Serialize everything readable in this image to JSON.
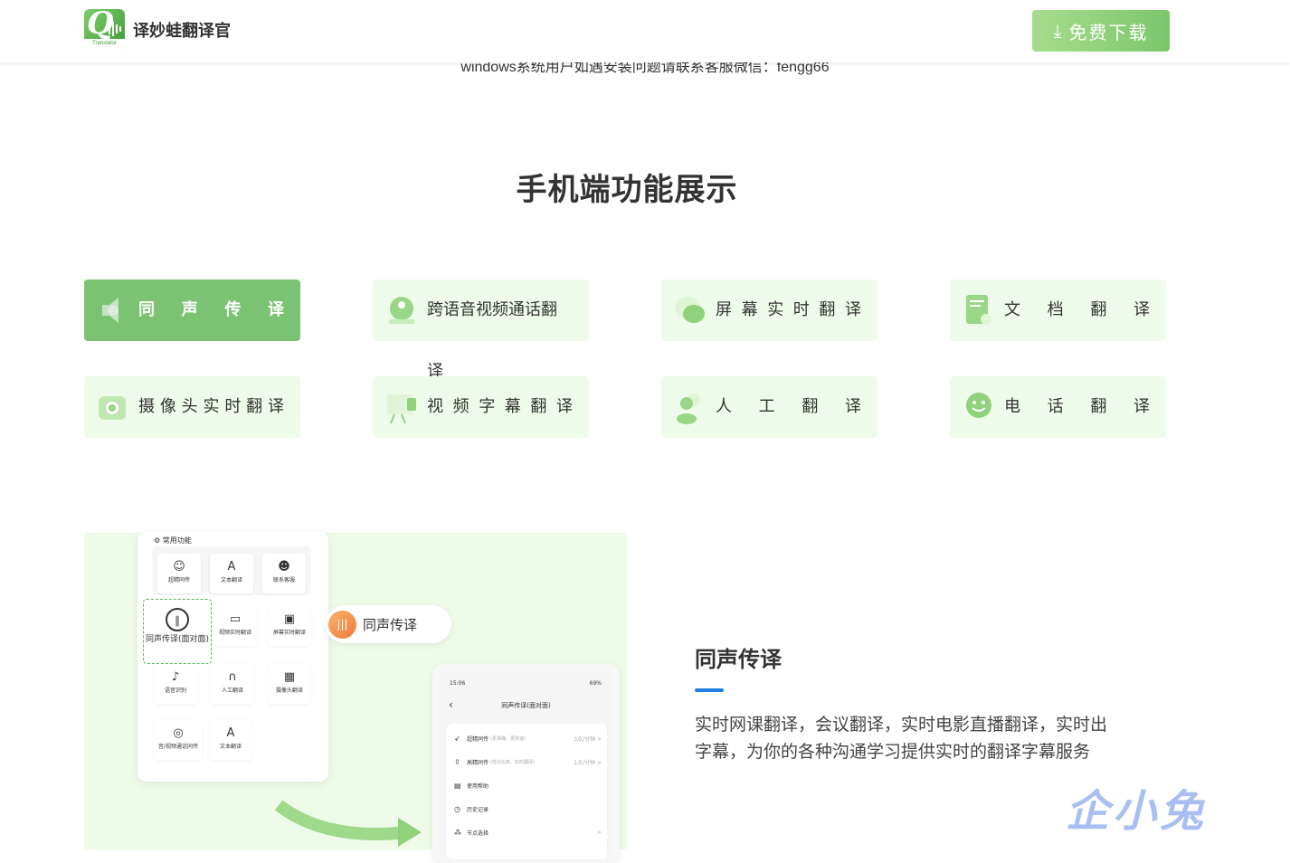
{
  "header": {
    "logo_tag": "Translator",
    "brand": "译妙蛙翻译官",
    "download_label": "免费下载",
    "download_icon": "download-icon"
  },
  "notice": "windows系统用户如遇安装问题请联系客服微信：fengg66",
  "section_title": "手机端功能展示",
  "tabs": [
    {
      "label": "同声传译",
      "icon": "speaker-icon",
      "active": true
    },
    {
      "label": "跨语音视频通话翻译",
      "icon": "video-call-icon",
      "active": false
    },
    {
      "label": "屏幕实时翻译",
      "icon": "chat-bubble-icon",
      "active": false
    },
    {
      "label": "文档翻译",
      "icon": "document-icon",
      "active": false
    },
    {
      "label": "摄像头实时翻译",
      "icon": "camera-icon",
      "active": false
    },
    {
      "label": "视频字幕翻译",
      "icon": "projector-icon",
      "active": false
    },
    {
      "label": "人工翻译",
      "icon": "people-icon",
      "active": false
    },
    {
      "label": "电话翻译",
      "icon": "phone-smile-icon",
      "active": false
    }
  ],
  "demo": {
    "panel_title": "常用功能",
    "items": [
      {
        "label": "超精同传",
        "glyph": "☺"
      },
      {
        "label": "文本翻译",
        "glyph": "A"
      },
      {
        "label": "联系客服",
        "glyph": "☻"
      },
      {
        "label": "同声传译(面对面)",
        "glyph": "∥"
      },
      {
        "label": "视频实时翻译",
        "glyph": "▭"
      },
      {
        "label": "屏幕实时翻译",
        "glyph": "▣"
      },
      {
        "label": "语音识别",
        "glyph": "♪"
      },
      {
        "label": "人工翻译",
        "glyph": "∩"
      },
      {
        "label": "摄像头翻译",
        "glyph": "▦"
      },
      {
        "label": "音/视频通话同传",
        "glyph": "◎"
      },
      {
        "label": "文本翻译",
        "glyph": "A"
      }
    ],
    "pill_label": "同声传译",
    "phone": {
      "time": "15:06",
      "status": "69%",
      "title": "同声传译(面对面)",
      "rows": [
        {
          "label": "超精同传",
          "sub": "(更准确、更快速)",
          "right": "3点/分钟 >"
        },
        {
          "label": "高精同传",
          "sub": "(性价比高、实时翻译)",
          "right": "1点/分钟 >"
        },
        {
          "label": "使用帮助",
          "sub": "",
          "right": ""
        },
        {
          "label": "历史记录",
          "sub": "",
          "right": ""
        },
        {
          "label": "节点选择",
          "sub": "",
          "right": ">"
        }
      ]
    }
  },
  "feature": {
    "title": "同声传译",
    "description": "实时网课翻译，会议翻译，实时电影直播翻译，实时出字幕，为你的各种沟通学习提供实时的翻译字幕服务"
  },
  "watermark": "企小兔",
  "colors": {
    "accent_green": "#7cc273",
    "tab_bg": "#effbea",
    "blue_line": "#1e7fe0"
  }
}
